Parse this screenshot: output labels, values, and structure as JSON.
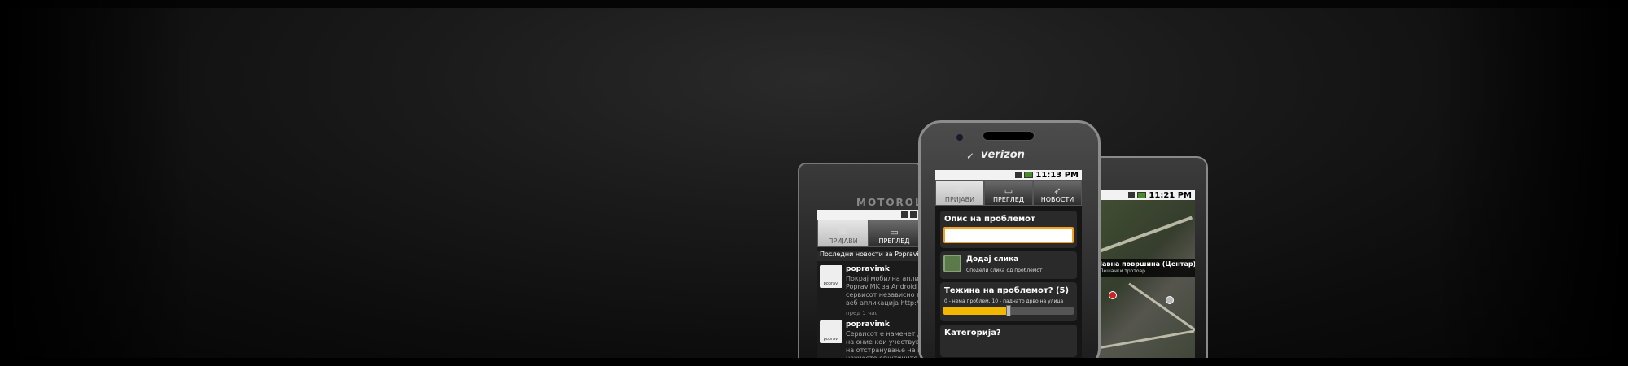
{
  "left_phone": {
    "brand": "MOTOROLA",
    "tabs": [
      {
        "label": "ПРИЈАВИ",
        "icon": "report-icon"
      },
      {
        "label": "ПРЕГЛЕД",
        "icon": "inbox-icon"
      }
    ],
    "news_header": "Последни новости за PopraviMK",
    "news": [
      {
        "author": "popravimk",
        "avatar_text": "popravi",
        "body": "Покрај мобилна апликац\nPopraviMK за Android п\nсервисот независно пос\nвеб апликација http://p",
        "time": "пред 1 час"
      },
      {
        "author": "popravimk",
        "avatar_text": "popravi",
        "body": "Сервисот е наменет да\nна оние кои учествува\nна отстранување на пр\nнаучесто општините.",
        "time": ""
      }
    ]
  },
  "center_phone": {
    "brand": "verizon",
    "status_time": "11:13 PM",
    "tabs": [
      {
        "label": "ПРИЈАВИ",
        "icon": "report-icon"
      },
      {
        "label": "ПРЕГЛЕД",
        "icon": "inbox-icon"
      },
      {
        "label": "НОВОСТИ",
        "icon": "bird-icon"
      }
    ],
    "description_title": "Опис на проблемот",
    "description_value": "",
    "add_photo_label": "Додај слика",
    "add_photo_sub": "Сподели слика од проблемот",
    "severity_title": "Тежина на проблемот? (5)",
    "severity_note": "0 - нема проблем, 10 - паднато дрво на улица",
    "severity_value": 5,
    "severity_max": 10,
    "category_title": "Категорија?",
    "accent_color": "#f5b800"
  },
  "right_phone": {
    "status_time": "11:21 PM",
    "map_label": "Јавна површина (Центар)",
    "map_sub": "Пешачки тротоар"
  }
}
